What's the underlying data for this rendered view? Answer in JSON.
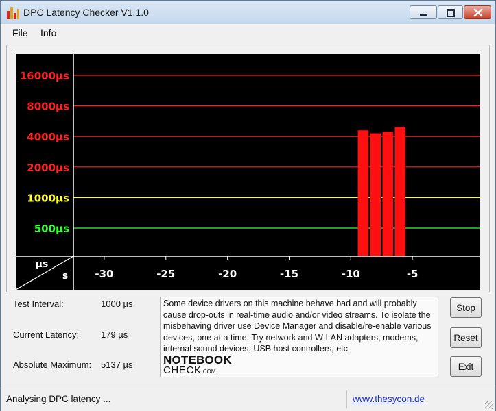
{
  "window": {
    "title": "DPC Latency Checker V1.1.0",
    "icon": "bar-chart-icon",
    "controls": [
      "minimize-icon",
      "maximize-icon",
      "close-icon"
    ]
  },
  "menu": {
    "items": [
      "File",
      "Info"
    ]
  },
  "chart_data": {
    "type": "bar",
    "y_scale": "log2",
    "ylabel": "µs",
    "xlabel": "s",
    "x_tick_labels": [
      "-30",
      "-25",
      "-20",
      "-15",
      "-10",
      "-5"
    ],
    "y_lines": [
      {
        "value": 16000,
        "label": "16000µs",
        "color": "#ff2020"
      },
      {
        "value": 8000,
        "label": "8000µs",
        "color": "#ff2020"
      },
      {
        "value": 4000,
        "label": "4000µs",
        "color": "#ff2020"
      },
      {
        "value": 2000,
        "label": "2000µs",
        "color": "#ff2020"
      },
      {
        "value": 1000,
        "label": "1000µs",
        "color": "#ffff33"
      },
      {
        "value": 500,
        "label": "500µs",
        "color": "#33ff33"
      }
    ],
    "x": [
      -32,
      -31,
      -30,
      -29,
      -28,
      -27,
      -26,
      -25,
      -24,
      -23,
      -22,
      -21,
      -20,
      -19,
      -18,
      -17,
      -16,
      -15,
      -14,
      -13,
      -12,
      -11,
      -10,
      -9,
      -8,
      -7,
      -6,
      -5,
      -4,
      -3,
      -2,
      -1,
      0
    ],
    "values": [
      185,
      180,
      215,
      210,
      225,
      200,
      175,
      215,
      210,
      175,
      185,
      225,
      220,
      185,
      195,
      210,
      240,
      205,
      185,
      205,
      200,
      165,
      185,
      4600,
      4300,
      4450,
      4950,
      200,
      195,
      210,
      205,
      195,
      179
    ],
    "bar_colors": {
      "normal": "#22ee22",
      "alert": "#ff0f0f"
    },
    "alert_threshold": 1000,
    "colors": {
      "background": "#000000",
      "axis": "#ffffff",
      "tick_labels": "#ffffff"
    }
  },
  "stats": [
    {
      "label": "Test Interval:",
      "value": "1000 µs"
    },
    {
      "label": "Current Latency:",
      "value": "179 µs"
    },
    {
      "label": "Absolute Maximum:",
      "value": "5137 µs"
    }
  ],
  "description": "Some device drivers on this machine behave bad and will probably cause drop-outs in real-time audio and/or video streams. To isolate the misbehaving driver use Device Manager and disable/re-enable various devices, one at a time. Try network and W-LAN adapters, modems, internal sound devices, USB host controllers, etc.",
  "logo": {
    "line1": "NOTEBOOK",
    "line2": "CHECK",
    "suffix": ".COM"
  },
  "buttons": {
    "stop": "Stop",
    "reset": "Reset",
    "exit": "Exit"
  },
  "status": {
    "text": "Analysing DPC latency ...",
    "link": "www.thesycon.de"
  }
}
